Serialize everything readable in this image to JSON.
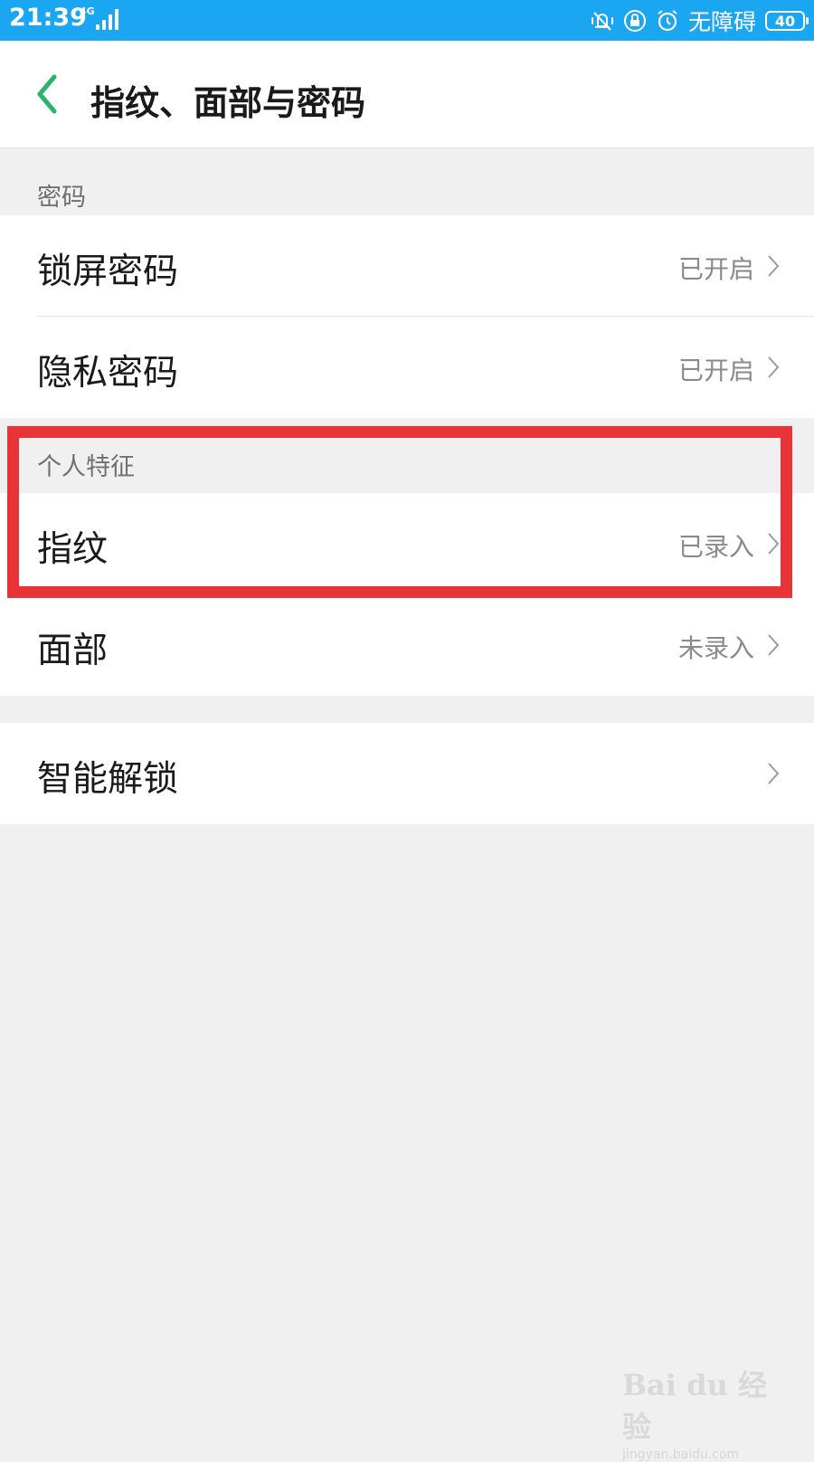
{
  "status_bar": {
    "time": "21:39",
    "network": "4G",
    "accessibility_label": "无障碍",
    "battery": "40",
    "icons": [
      "vibrate-icon",
      "lock-rotation-icon",
      "alarm-icon",
      "signal-icon",
      "battery-icon"
    ]
  },
  "header": {
    "title": "指纹、面部与密码",
    "back_icon": "chevron-left-icon"
  },
  "sections": {
    "password": {
      "label": "密码",
      "items": [
        {
          "title": "锁屏密码",
          "value": "已开启"
        },
        {
          "title": "隐私密码",
          "value": "已开启"
        }
      ]
    },
    "biometrics": {
      "label": "个人特征",
      "items": [
        {
          "title": "指纹",
          "value": "已录入"
        },
        {
          "title": "面部",
          "value": "未录入"
        }
      ]
    },
    "smart": {
      "items": [
        {
          "title": "智能解锁",
          "value": ""
        }
      ]
    }
  },
  "watermark": {
    "logo": "Bai du 经验",
    "url": "jingyan.baidu.com"
  },
  "colors": {
    "status_bar": "#1aa6f0",
    "accent": "#2ab36e",
    "highlight_box": "#e83438"
  }
}
